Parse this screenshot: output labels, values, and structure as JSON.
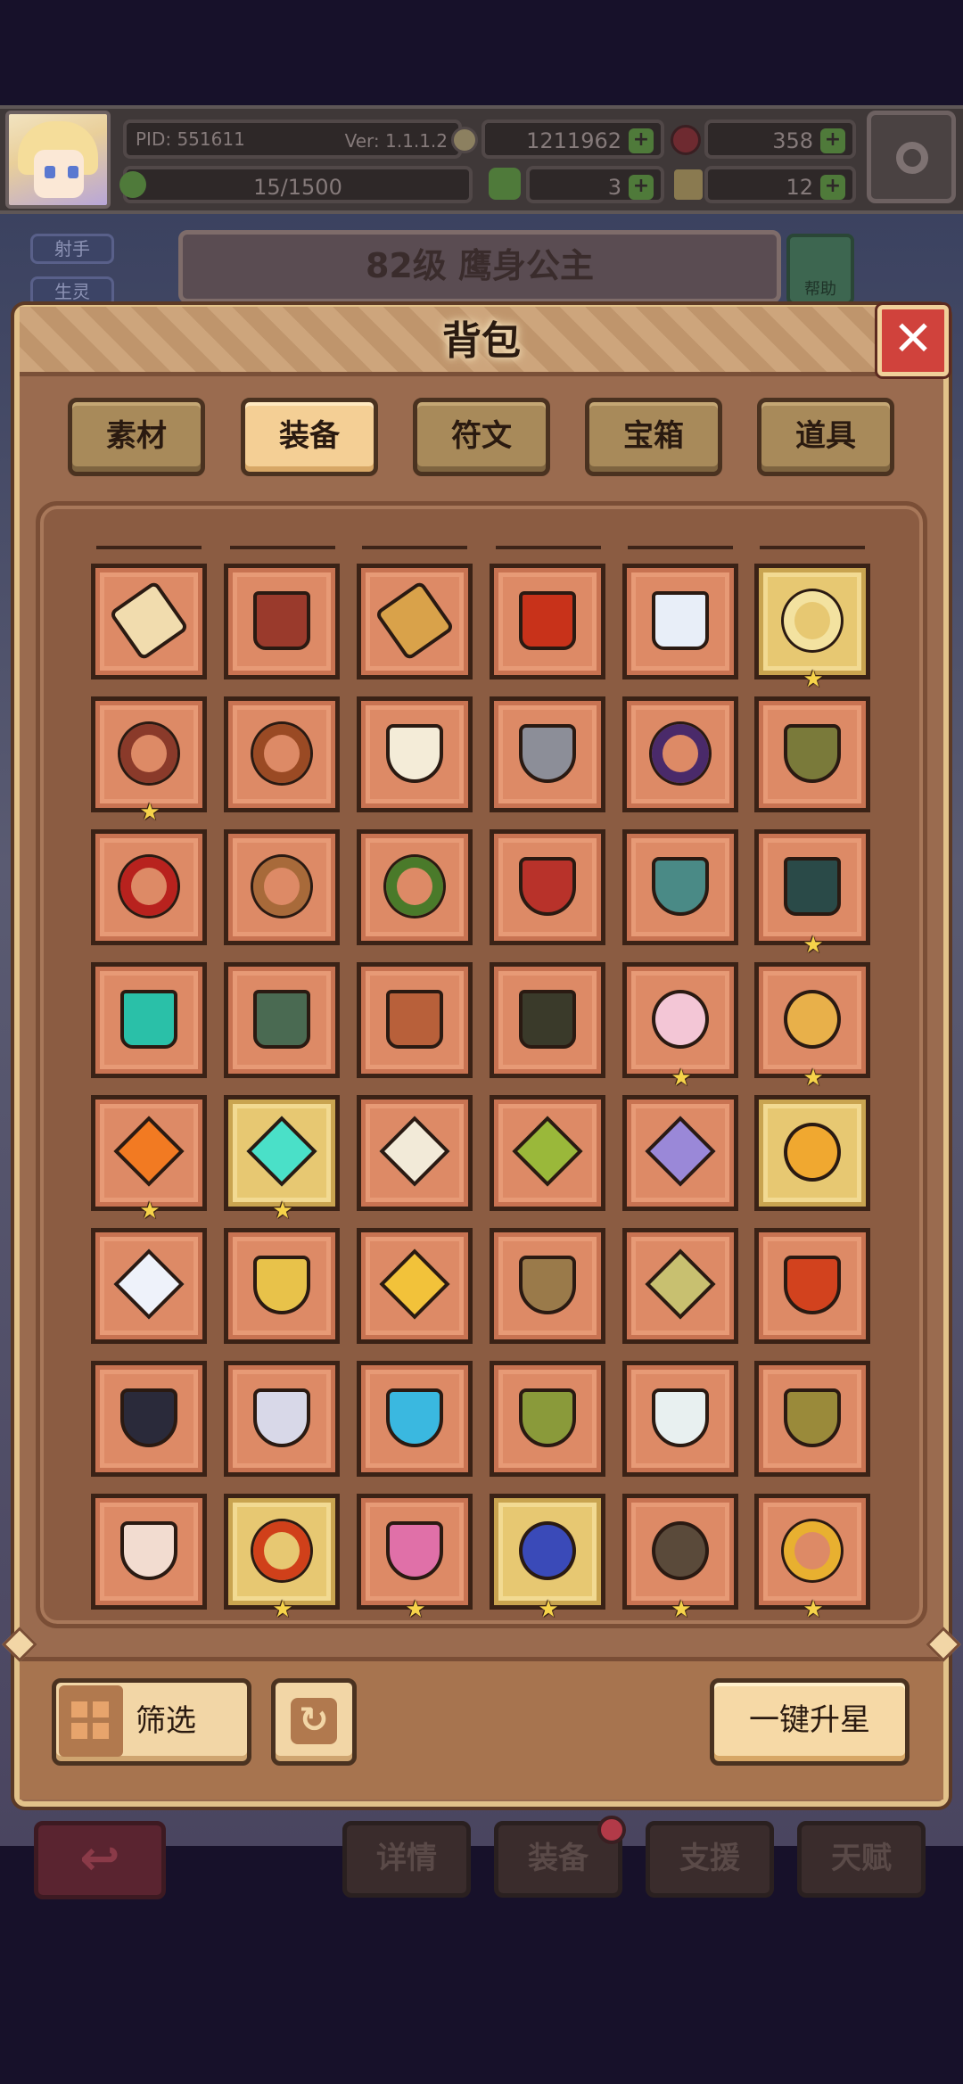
{
  "hud": {
    "pid": "PID: 551611",
    "version": "Ver: 1.1.1.2",
    "gold": "1211962",
    "gems": "358",
    "energy": "15/1500",
    "clovers": "3",
    "keys": "12",
    "plus": "+"
  },
  "background": {
    "side_tags": [
      "射手",
      "生灵"
    ],
    "hero_title": "82级 鹰身公主",
    "help_label": "帮助",
    "back_icon": "↩",
    "bottom_tabs": [
      "详情",
      "装备",
      "支援",
      "天赋"
    ]
  },
  "panel": {
    "title": "背包",
    "close_label": "✕",
    "tabs": [
      {
        "label": "素材",
        "active": false
      },
      {
        "label": "装备",
        "active": true
      },
      {
        "label": "符文",
        "active": false
      },
      {
        "label": "宝箱",
        "active": false
      },
      {
        "label": "道具",
        "active": false
      }
    ],
    "filter_label": "筛选",
    "refresh_icon": "↻",
    "upstar_label": "一键升星"
  },
  "inventory": [
    [
      {
        "icon": "scroll-icon",
        "color": "#f1dcae",
        "shape": "s-scroll",
        "gold": false,
        "star": false
      },
      {
        "icon": "gauntlet-icon",
        "color": "#9a3a2c",
        "shape": "s-boot",
        "gold": false,
        "star": false
      },
      {
        "icon": "bracer-icon",
        "color": "#d9a24a",
        "shape": "s-scroll",
        "gold": false,
        "star": false
      },
      {
        "icon": "lava-armor-icon",
        "color": "#c8321a",
        "shape": "s-boot",
        "gold": false,
        "star": false
      },
      {
        "icon": "crystal-glove-icon",
        "color": "#e8eef8",
        "shape": "s-boot",
        "gold": false,
        "star": false
      },
      {
        "icon": "gold-bracelet-icon",
        "color": "#f3e2a0",
        "shape": "s-ring",
        "gold": true,
        "star": true
      }
    ],
    [
      {
        "icon": "jeweled-belt-icon",
        "color": "#8a3a2a",
        "shape": "s-ring",
        "gold": false,
        "star": true
      },
      {
        "icon": "emerald-belt-icon",
        "color": "#9a4a24",
        "shape": "s-ring",
        "gold": false,
        "star": false
      },
      {
        "icon": "white-belt-icon",
        "color": "#f4ecd8",
        "shape": "s-amulet",
        "gold": false,
        "star": false
      },
      {
        "icon": "stone-belt-icon",
        "color": "#8c8e98",
        "shape": "s-amulet",
        "gold": false,
        "star": false
      },
      {
        "icon": "violet-belt-icon",
        "color": "#4a2a6a",
        "shape": "s-ring",
        "gold": false,
        "star": false
      },
      {
        "icon": "olive-belt-icon",
        "color": "#7a7a3a",
        "shape": "s-amulet",
        "gold": false,
        "star": false
      }
    ],
    [
      {
        "icon": "ruby-belt-icon",
        "color": "#b8221e",
        "shape": "s-ring",
        "gold": false,
        "star": false
      },
      {
        "icon": "bronze-ring-icon",
        "color": "#a86a3a",
        "shape": "s-ring",
        "gold": false,
        "star": false
      },
      {
        "icon": "jade-ring-icon",
        "color": "#4a7a2a",
        "shape": "s-ring",
        "gold": false,
        "star": false
      },
      {
        "icon": "crown-belt-icon",
        "color": "#b8322a",
        "shape": "s-amulet",
        "gold": false,
        "star": false
      },
      {
        "icon": "teal-cape-icon",
        "color": "#4a8a86",
        "shape": "s-amulet",
        "gold": false,
        "star": false
      },
      {
        "icon": "dark-boots-icon",
        "color": "#2a4a48",
        "shape": "s-boot",
        "gold": false,
        "star": true
      }
    ],
    [
      {
        "icon": "emerald-boots-icon",
        "color": "#2ac0a8",
        "shape": "s-boot",
        "gold": false,
        "star": false
      },
      {
        "icon": "iron-boots-icon",
        "color": "#4a6a52",
        "shape": "s-boot",
        "gold": false,
        "star": false
      },
      {
        "icon": "leather-boots-icon",
        "color": "#b8603a",
        "shape": "s-boot",
        "gold": false,
        "star": false
      },
      {
        "icon": "shadow-boots-icon",
        "color": "#3a3a2a",
        "shape": "s-boot",
        "gold": false,
        "star": false
      },
      {
        "icon": "heart-charm-icon",
        "color": "#f3c6d6",
        "shape": "s-round",
        "gold": false,
        "star": true
      },
      {
        "icon": "sun-eye-icon",
        "color": "#e8b04a",
        "shape": "s-round",
        "gold": false,
        "star": true
      }
    ],
    [
      {
        "icon": "fire-gem-icon",
        "color": "#f27a22",
        "shape": "s-gem",
        "gold": false,
        "star": true
      },
      {
        "icon": "aqua-gem-icon",
        "color": "#4ae0c8",
        "shape": "s-gem",
        "gold": true,
        "star": true
      },
      {
        "icon": "pearl-gem-icon",
        "color": "#f2ead8",
        "shape": "s-gem",
        "gold": false,
        "star": false
      },
      {
        "icon": "leaf-gem-icon",
        "color": "#9ab83a",
        "shape": "s-gem",
        "gold": false,
        "star": false
      },
      {
        "icon": "amethyst-gem-icon",
        "color": "#9a88d8",
        "shape": "s-gem",
        "gold": false,
        "star": false
      },
      {
        "icon": "amber-coin-icon",
        "color": "#f0a830",
        "shape": "s-round",
        "gold": true,
        "star": false
      }
    ],
    [
      {
        "icon": "star-crystal-icon",
        "color": "#eef2fa",
        "shape": "s-gem",
        "gold": false,
        "star": false
      },
      {
        "icon": "gold-shield-icon",
        "color": "#e8c24a",
        "shape": "s-amulet",
        "gold": false,
        "star": false
      },
      {
        "icon": "sun-emblem-icon",
        "color": "#f2c23a",
        "shape": "s-gem",
        "gold": false,
        "star": false
      },
      {
        "icon": "bronze-relic-icon",
        "color": "#9a7a4a",
        "shape": "s-amulet",
        "gold": false,
        "star": false
      },
      {
        "icon": "amethyst-relic-icon",
        "color": "#c8c070",
        "shape": "s-gem",
        "gold": false,
        "star": false
      },
      {
        "icon": "flame-heart-icon",
        "color": "#d2421e",
        "shape": "s-amulet",
        "gold": false,
        "star": false
      }
    ],
    [
      {
        "icon": "black-necklace-icon",
        "color": "#2a2a3a",
        "shape": "s-amulet",
        "gold": false,
        "star": false
      },
      {
        "icon": "silver-necklace-icon",
        "color": "#d8d8e8",
        "shape": "s-amulet",
        "gold": false,
        "star": false
      },
      {
        "icon": "sapphire-necklace-icon",
        "color": "#3ab8e0",
        "shape": "s-amulet",
        "gold": false,
        "star": false
      },
      {
        "icon": "emerald-necklace-icon",
        "color": "#8a9a3a",
        "shape": "s-amulet",
        "gold": false,
        "star": false
      },
      {
        "icon": "aqua-necklace-icon",
        "color": "#e8f0f0",
        "shape": "s-amulet",
        "gold": false,
        "star": false
      },
      {
        "icon": "jeweled-necklace-icon",
        "color": "#9a8a3a",
        "shape": "s-amulet",
        "gold": false,
        "star": false
      }
    ],
    [
      {
        "icon": "heart-pendant-icon",
        "color": "#f2dcd0",
        "shape": "s-amulet",
        "gold": false,
        "star": false
      },
      {
        "icon": "fire-ring-icon",
        "color": "#d0401a",
        "shape": "s-ring",
        "gold": true,
        "star": true
      },
      {
        "icon": "pink-heart-icon",
        "color": "#e070a8",
        "shape": "s-amulet",
        "gold": false,
        "star": true
      },
      {
        "icon": "sapphire-ring-icon",
        "color": "#3a4ab8",
        "shape": "s-round",
        "gold": true,
        "star": true
      },
      {
        "icon": "onyx-ring-icon",
        "color": "#5a4a3a",
        "shape": "s-round",
        "gold": false,
        "star": true
      },
      {
        "icon": "gold-ring-icon",
        "color": "#e8b030",
        "shape": "s-ring",
        "gold": false,
        "star": true
      }
    ]
  ]
}
